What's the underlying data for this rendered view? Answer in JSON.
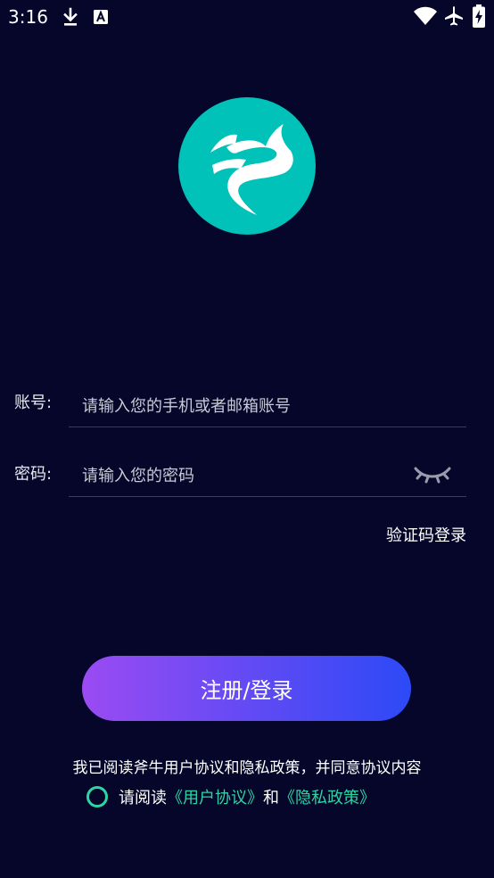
{
  "status_bar": {
    "time": "3:16",
    "icons": [
      "download-icon",
      "font-a-icon",
      "wifi-icon",
      "airplane-icon",
      "battery-charging-icon"
    ]
  },
  "logo": {
    "icon": "brand-swirl-logo-icon",
    "color": "#00c2b8"
  },
  "form": {
    "account": {
      "label": "账号:",
      "placeholder": "请输入您的手机或者邮箱账号",
      "value": ""
    },
    "password": {
      "label": "密码:",
      "placeholder": "请输入您的密码",
      "value": "",
      "toggle_icon": "eye-closed-icon"
    },
    "code_login_link": "验证码登录"
  },
  "submit": {
    "label": "注册/登录",
    "gradient_start": "#9b4bf2",
    "gradient_end": "#2c4af6"
  },
  "agreement": {
    "statement": "我已阅读斧牛用户协议和隐私政策，并同意协议内容",
    "prefix": "请阅读",
    "user_agreement": "《用户协议》",
    "and": "和",
    "privacy_policy": "《隐私政策》",
    "link_color": "#2ed4a4",
    "checked": false
  },
  "colors": {
    "background": "#050629",
    "text": "#ffffff"
  }
}
